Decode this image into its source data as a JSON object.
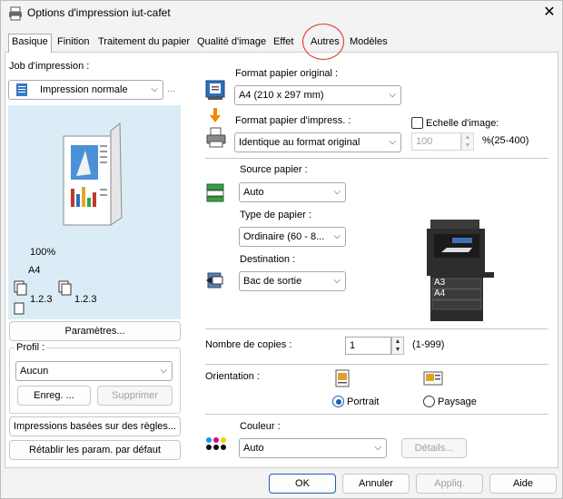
{
  "window": {
    "title": "Options d'impression iut-cafet",
    "close": "✕"
  },
  "tabs": [
    {
      "label": "Basique"
    },
    {
      "label": "Finition"
    },
    {
      "label": "Traitement du papier"
    },
    {
      "label": "Qualité d'image"
    },
    {
      "label": "Effet"
    },
    {
      "label": "Autres"
    },
    {
      "label": "Modèles"
    }
  ],
  "job": {
    "label": "Job d'impression :",
    "value": "Impression normale",
    "more": "..."
  },
  "preview": {
    "zoom": "100%",
    "paper": "A4",
    "collate1": "1.2.3",
    "collate2": "1.2.3"
  },
  "left_buttons": {
    "parametres": "Paramètres...",
    "profil_label": "Profil :",
    "profil_value": "Aucun",
    "enreg": "Enreg. ...",
    "supprimer": "Supprimer",
    "rules": "Impressions basées sur des règles...",
    "reset": "Rétablir les param. par défaut"
  },
  "paper": {
    "original_label": "Format papier original :",
    "original_value": "A4 (210 x 297 mm)",
    "print_label": "Format papier d'impress. :",
    "print_value": "Identique au format original",
    "scale_label": "Echelle d'image:",
    "scale_value": "100",
    "scale_range": "%(25-400)"
  },
  "source": {
    "source_label": "Source papier :",
    "source_value": "Auto",
    "type_label": "Type de papier :",
    "type_value": "Ordinaire (60 - 8...",
    "dest_label": "Destination :",
    "dest_value": "Bac de sortie"
  },
  "printer_labels": {
    "tray1": "A3",
    "tray2": "A4"
  },
  "copies": {
    "label": "Nombre de copies :",
    "value": "1",
    "range": "(1-999)"
  },
  "orientation": {
    "label": "Orientation :",
    "portrait": "Portrait",
    "paysage": "Paysage",
    "selected": "portrait"
  },
  "color": {
    "label": "Couleur :",
    "value": "Auto",
    "details": "Détails..."
  },
  "footer": {
    "ok": "OK",
    "annuler": "Annuler",
    "appliq": "Appliq.",
    "aide": "Aide"
  },
  "spin_up": "▲",
  "spin_down": "▼",
  "chevron": "⌵"
}
